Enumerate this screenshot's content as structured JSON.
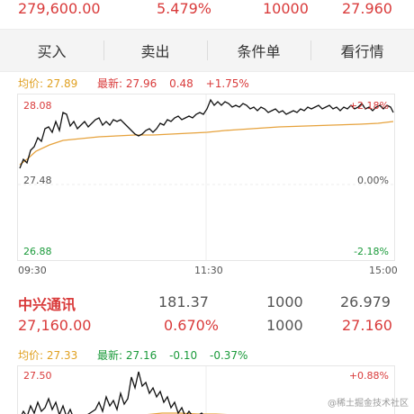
{
  "top_quote": {
    "amount": "279,600.00",
    "percent": "5.479%",
    "volume": "10000",
    "price": "27.960"
  },
  "actions": {
    "buy": "买入",
    "sell": "卖出",
    "condition": "条件单",
    "watch": "看行情"
  },
  "chart1": {
    "avg_label": "均价: 27.89",
    "latest_label": "最新: 27.96",
    "change": "0.48",
    "change_pct": "+1.75%",
    "y_top": "28.08",
    "y_mid": "27.48",
    "y_bottom": "26.88",
    "pct_top": "+2.18%",
    "pct_mid": "0.00%",
    "pct_bottom": "-2.18%",
    "time_start": "09:30",
    "time_mid": "11:30",
    "time_end": "15:00"
  },
  "stock": {
    "name": "中兴通讯",
    "price": "181.37",
    "qty": "1000",
    "cost": "26.979",
    "amount": "27,160.00",
    "percent": "0.670%",
    "qty2": "1000",
    "price2": "27.160"
  },
  "chart2": {
    "avg_label": "均价: 27.33",
    "latest_label": "最新: 27.16",
    "change": "-0.10",
    "change_pct": "-0.37%",
    "y_top": "27.50",
    "pct_top": "+0.88%"
  },
  "watermark": "@稀土掘金技术社区"
}
